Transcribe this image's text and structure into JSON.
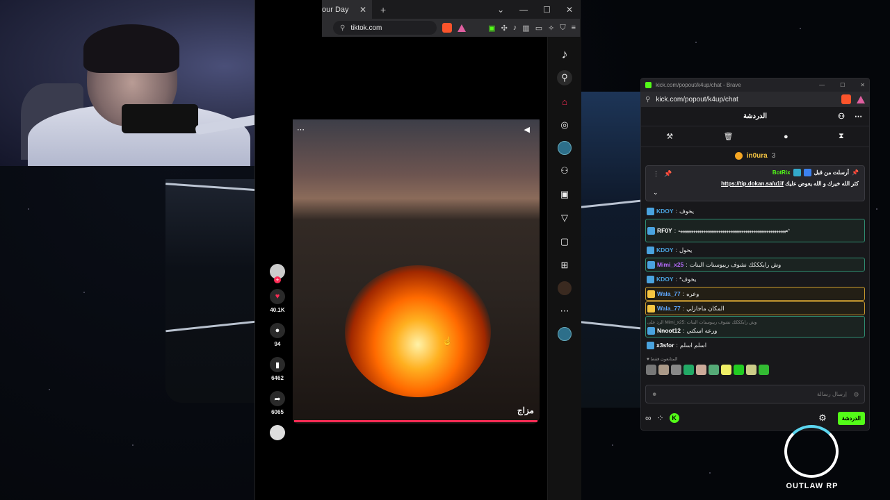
{
  "browser": {
    "tab_title": "our Day",
    "url": "tiktok.com",
    "video": {
      "caption": "مزاج",
      "progress_fraction": 1.0
    },
    "actions": {
      "likes": "40.1K",
      "comments": "94",
      "saves": "6462",
      "shares": "6065"
    },
    "sidebar_icons": [
      "tiktok-logo-icon",
      "search-icon",
      "home-icon",
      "explore-icon",
      "profile-avatar-icon",
      "friends-icon",
      "live-icon",
      "send-icon",
      "inbox-icon",
      "upload-icon",
      "avatar-small-icon",
      "more-icon",
      "avatar-stack-icon"
    ]
  },
  "kick": {
    "window_title": "kick.com/popout/k4up/chat - Brave",
    "url": "kick.com/popout/k4up/chat",
    "chat_title": "الدردشة",
    "top_gifter": {
      "name": "in0ura",
      "count": "3"
    },
    "pinned": {
      "pinned_by": "أرسلت من قبل",
      "bot_name": "BotRix",
      "text": "كثر الله خيرك و الله يعوض عليك",
      "link": "https://tip.dokan.sa/u1if"
    },
    "messages": [
      {
        "user": "KDOY",
        "text": "يخوف",
        "style": "plain",
        "user_color": "#4aa3df"
      },
      {
        "user": "RF0Y",
        "text": "ههههههههههههههههههههههههههههههههههههههههههههههههههههههههه*",
        "style": "box",
        "user_color": "#ffffff"
      },
      {
        "user": "KDOY",
        "text": "يحول",
        "style": "plain",
        "user_color": "#4aa3df"
      },
      {
        "user": "Mimi_x25",
        "text": "وش رايكككك نشوف ريبوسنات البنات",
        "style": "box",
        "user_color": "#b86cff"
      },
      {
        "user": "KDOY",
        "text": "*يخوف",
        "style": "plain",
        "user_color": "#4aa3df"
      },
      {
        "user": "Wala_77",
        "text": "وعره",
        "style": "gold",
        "user_color": "#5fa8ff"
      },
      {
        "user": "Wala_77",
        "text": "المكان ماجازلي",
        "style": "gold",
        "user_color": "#5fa8ff"
      },
      {
        "user": "Nnoot12",
        "text": "ورعه اسكتي",
        "style": "reply",
        "user_color": "#ffffff",
        "reply_to": "الرد على Mimi_x25: وش رايكككك نشوف ريبوسنات البنات"
      },
      {
        "user": "x3sfor",
        "text": "اسلم اسلم",
        "style": "plain",
        "user_color": "#ffffff"
      }
    ],
    "viewers_label": "المتابعون فقط",
    "input_placeholder": "إرسال رسالة",
    "send_label": "الدردشة"
  },
  "overlay": {
    "logo_text": "OUTLAW RP"
  },
  "colors": {
    "kick_green": "#53fc18",
    "tiktok_red": "#fe2c55"
  }
}
